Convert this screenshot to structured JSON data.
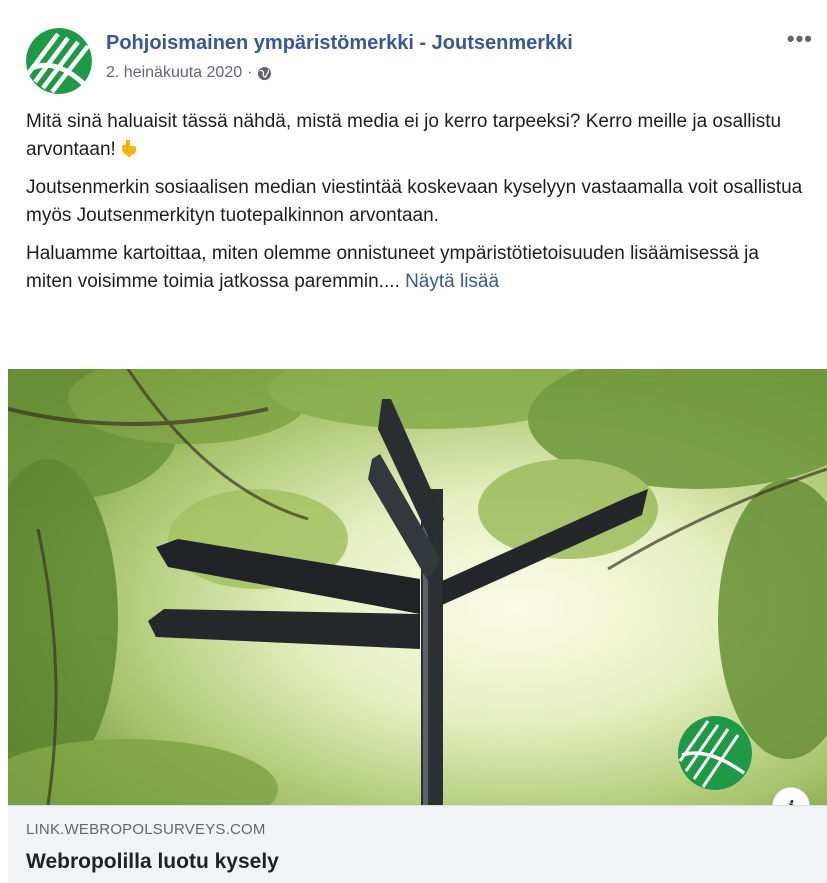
{
  "post": {
    "page_name": "Pohjoismainen ympäristömerkki - Joutsenmerkki",
    "date": "2. heinäkuuta 2020",
    "separator": "·",
    "privacy_icon": "globe-icon",
    "more_label": "•••",
    "paragraphs": [
      "Mitä sinä haluaisit tässä nähdä, mistä media ei jo kerro tarpeeksi? Kerro meille ja osallistu arvontaan!",
      "Joutsenmerkin sosiaalisen median viestintää koskevaan kyselyyn vastaamalla voit osallistua myös Joutsenmerkityn tuotepalkinnon arvontaan.",
      "Haluamme kartoittaa, miten olemme onnistuneet ympäristötietoisuuden lisäämisessä ja miten voisimme toimia jatkossa paremmin...."
    ],
    "see_more": "Näytä lisää",
    "emoji": "backhand-index-pointing-down-emoji"
  },
  "link_preview": {
    "domain": "LINK.WEBROPOLSURVEYS.COM",
    "title": "Webropolilla luotu kysely",
    "info_label": "i"
  },
  "colors": {
    "link_blue": "#365899",
    "logo_green": "#1e9a46",
    "secondary_text": "#606770",
    "preview_bg": "#f2f3f5"
  }
}
